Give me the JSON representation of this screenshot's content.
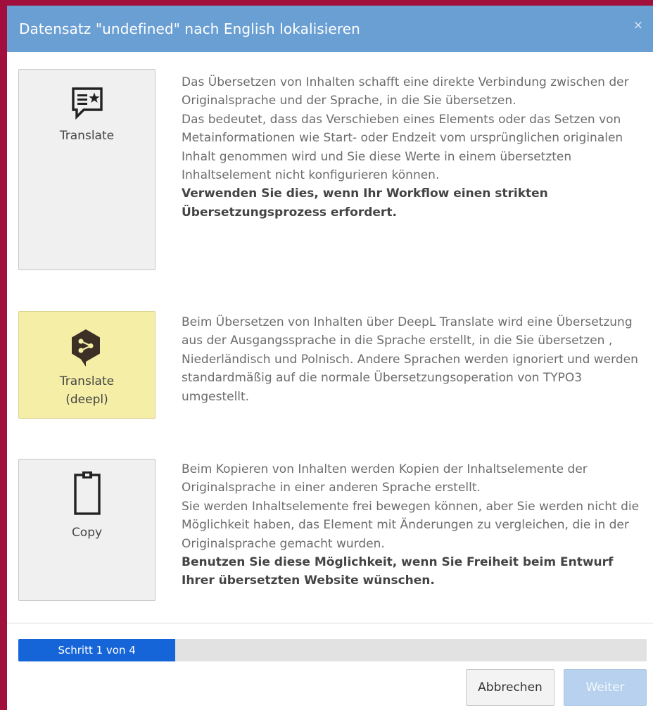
{
  "dialog": {
    "title": "Datensatz \"undefined\" nach English lokalisieren",
    "close_symbol": "×"
  },
  "options": [
    {
      "icon": "message-star-icon",
      "label": "Translate",
      "active": false,
      "paragraphs": [
        "Das Übersetzen von Inhalten schafft eine direkte Verbindung zwischen der Originalsprache und der Sprache, in die Sie übersetzen.",
        "Das bedeutet, dass das Verschieben eines Elements oder das Setzen von Metainformationen wie Start- oder Endzeit vom ursprünglichen originalen Inhalt genommen wird und Sie diese Werte in einem übersetzten Inhaltselement nicht konfigurieren können."
      ],
      "strong": "Verwenden Sie dies, wenn Ihr Workflow einen strikten Übersetzungsprozess erfordert."
    },
    {
      "icon": "deepl-logo-icon",
      "label": "Translate (deepl)",
      "active": true,
      "paragraphs": [
        "Beim Übersetzen von Inhalten über DeepL Translate wird eine Übersetzung aus der Ausgangssprache in die Sprache erstellt, in die Sie übersetzen , Niederländisch und Polnisch. Andere Sprachen werden ignoriert und werden standardmäßig auf die normale Übersetzungsoperation von TYPO3 umgestellt."
      ],
      "strong": ""
    },
    {
      "icon": "clipboard-icon",
      "label": "Copy",
      "active": false,
      "paragraphs": [
        "Beim Kopieren von Inhalten werden Kopien der Inhaltselemente der Originalsprache in einer anderen Sprache erstellt.",
        "Sie werden Inhaltselemente frei bewegen können, aber Sie werden nicht die Möglichkeit haben, das Element mit Änderungen zu vergleichen, die in der Originalsprache gemacht wurden."
      ],
      "strong": "Benutzen Sie diese Möglichkeit, wenn Sie Freiheit beim Entwurf Ihrer übersetzten Website wünschen."
    }
  ],
  "progress": {
    "label": "Schritt 1 von 4",
    "value": 0.25
  },
  "footer": {
    "cancel_label": "Abbrechen",
    "next_label": "Weiter",
    "next_disabled": true
  },
  "colors": {
    "header": "#6a9fd3",
    "active_card": "#f4eea6",
    "progress_fill": "#1565d8",
    "deepl_icon": "#3c3026",
    "window_border": "#a10f3c"
  }
}
